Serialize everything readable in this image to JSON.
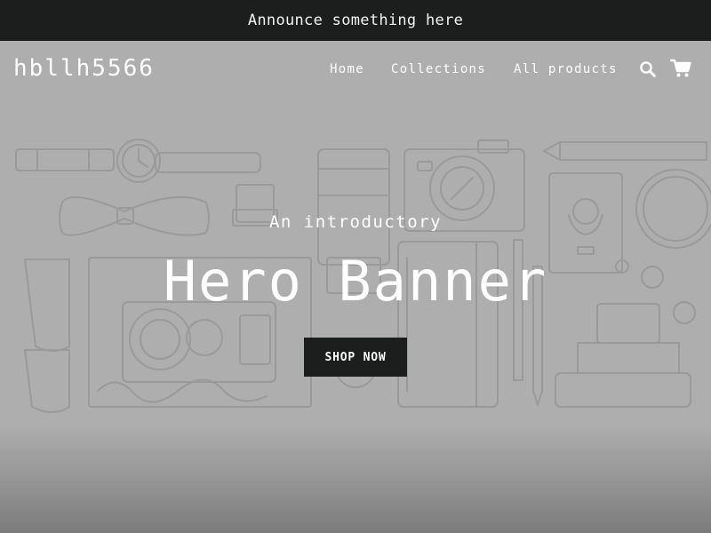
{
  "announcement": {
    "text": "Announce something here"
  },
  "header": {
    "logo": "hbllh5566",
    "nav": [
      {
        "label": "Home"
      },
      {
        "label": "Collections"
      },
      {
        "label": "All products"
      }
    ],
    "icons": {
      "search": "search-icon",
      "cart": "cart-icon"
    }
  },
  "hero": {
    "subheading": "An introductory",
    "heading": "Hero Banner",
    "button_label": "SHOP NOW"
  },
  "colors": {
    "announcement_bg": "#1c1d1d",
    "hero_overlay": "#aeaeae",
    "button_bg": "#1c1d1d",
    "text": "#ffffff"
  }
}
